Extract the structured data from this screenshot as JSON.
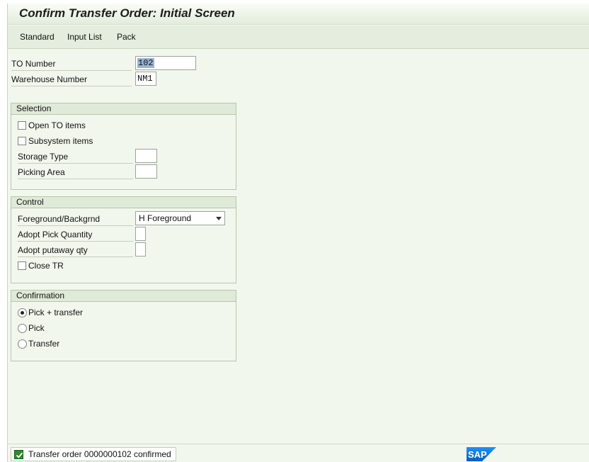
{
  "window": {
    "title": "Confirm Transfer Order: Initial Screen"
  },
  "toolbar": {
    "standard": "Standard",
    "input_list": "Input List",
    "pack": "Pack"
  },
  "header_fields": {
    "to_number_label": "TO Number",
    "to_number_value": "102",
    "warehouse_label": "Warehouse Number",
    "warehouse_value": "NM1"
  },
  "selection": {
    "title": "Selection",
    "open_to_items": "Open TO items",
    "subsystem_items": "Subsystem items",
    "storage_type_label": "Storage Type",
    "picking_area_label": "Picking Area"
  },
  "control": {
    "title": "Control",
    "fg_bg_label": "Foreground/Backgrnd",
    "fg_bg_value": "H Foreground",
    "adopt_pick_label": "Adopt Pick Quantity",
    "adopt_putaway_label": "Adopt putaway qty",
    "close_tr_label": "Close TR"
  },
  "confirmation": {
    "title": "Confirmation",
    "pick_transfer": "Pick + transfer",
    "pick": "Pick",
    "transfer": "Transfer",
    "selected": "Pick + transfer"
  },
  "status": {
    "message": "Transfer order 0000000102 confirmed",
    "type": "success"
  },
  "brand": {
    "logo": "SAP"
  },
  "colors": {
    "background": "#f2f7ee",
    "header_band": "#e0ead8",
    "success": "#2e8b2e",
    "logo_blue": "#0a6ed1"
  }
}
